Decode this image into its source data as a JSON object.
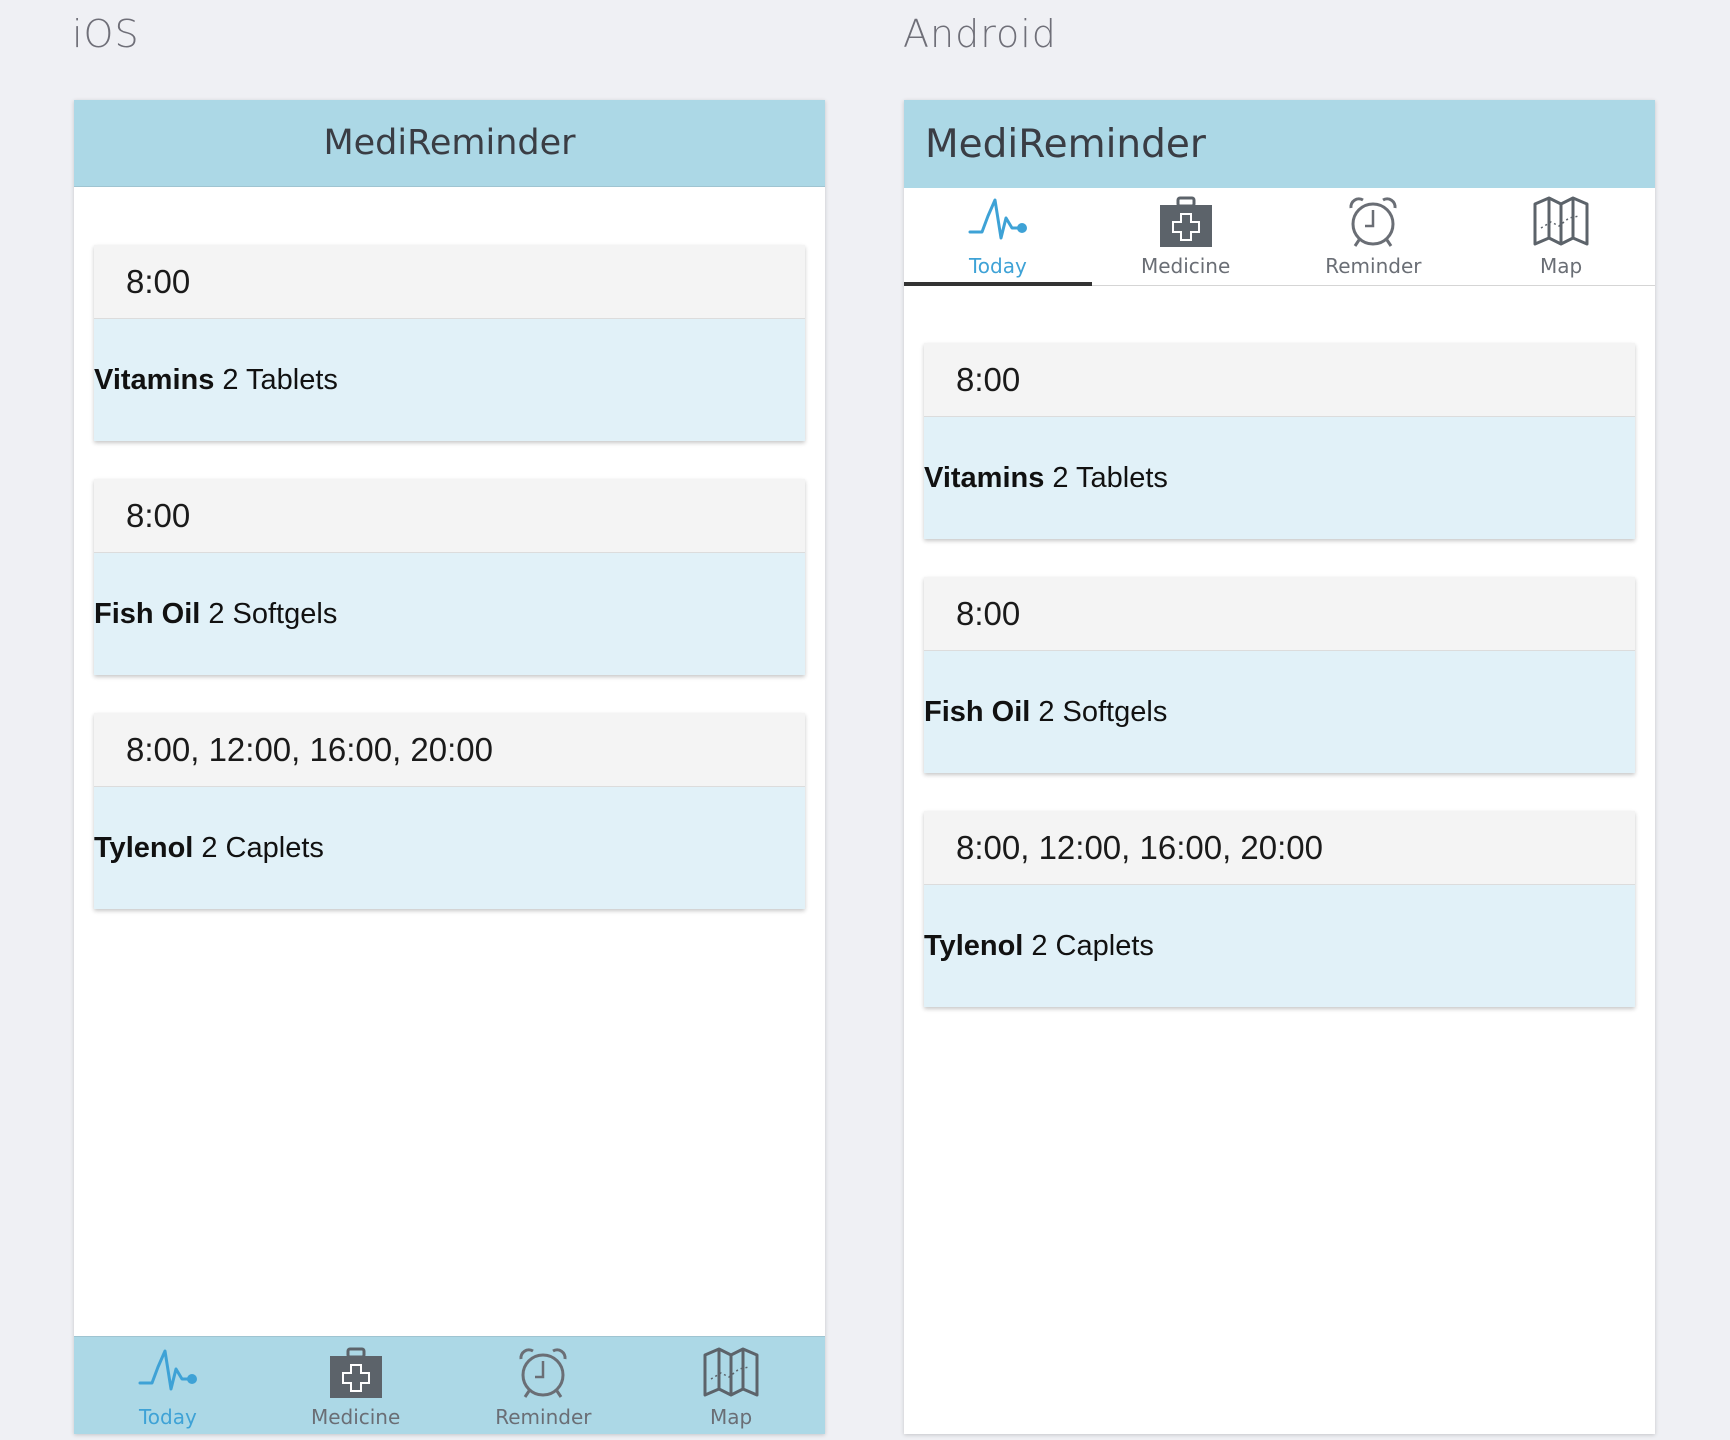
{
  "platforms": {
    "ios_label": "iOS",
    "android_label": "Android"
  },
  "app": {
    "title": "MediReminder"
  },
  "tabs": [
    {
      "label": "Today",
      "icon": "heartbeat-icon",
      "active": true
    },
    {
      "label": "Medicine",
      "icon": "medicine-kit-icon",
      "active": false
    },
    {
      "label": "Reminder",
      "icon": "alarm-clock-icon",
      "active": false
    },
    {
      "label": "Map",
      "icon": "map-icon",
      "active": false
    }
  ],
  "reminders": [
    {
      "time": "8:00",
      "name": "Vitamins",
      "dose": "2 Tablets"
    },
    {
      "time": "8:00",
      "name": "Fish Oil",
      "dose": "2 Softgels"
    },
    {
      "time": "8:00, 12:00, 16:00, 20:00",
      "name": "Tylenol",
      "dose": "2 Caplets"
    }
  ],
  "colors": {
    "header_bg": "#acd8e6",
    "card_body_bg": "#e1f1f8",
    "card_time_bg": "#f4f4f4",
    "active_tab": "#3ea2d6",
    "inactive_tab": "#6a6e75",
    "page_bg": "#eff0f4"
  }
}
